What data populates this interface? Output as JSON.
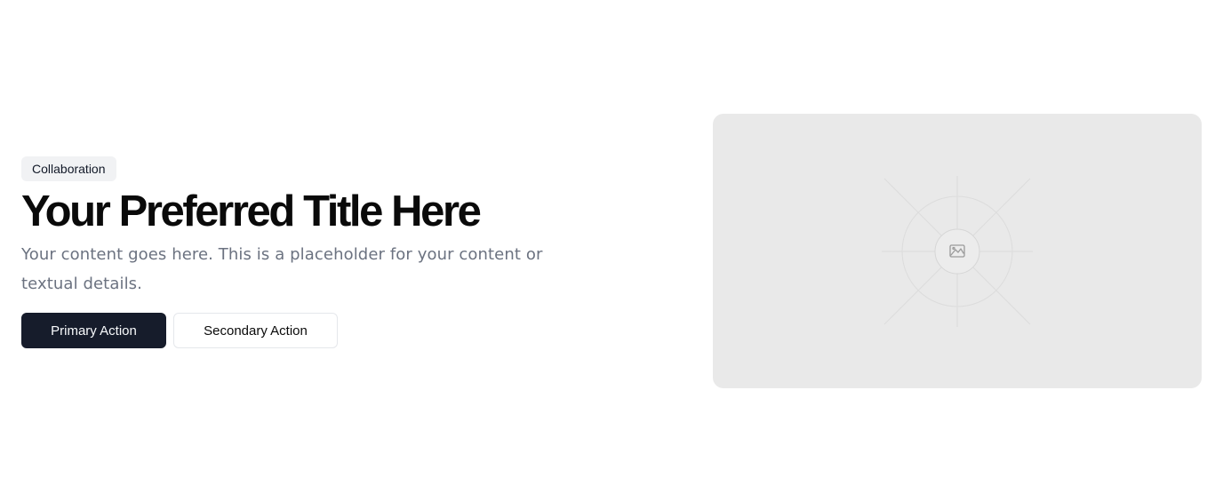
{
  "hero": {
    "badge": "Collaboration",
    "title": "Your Preferred Title Here",
    "description": "Your content goes here. This is a placeholder for your content or textual details.",
    "primary_action": "Primary Action",
    "secondary_action": "Secondary Action"
  },
  "media": {
    "icon": "image-placeholder-icon",
    "background_color": "#e9e9e9"
  },
  "colors": {
    "primary_button": "#161c2b",
    "badge_background": "#f1f2f4",
    "muted_text": "#6b7280"
  }
}
